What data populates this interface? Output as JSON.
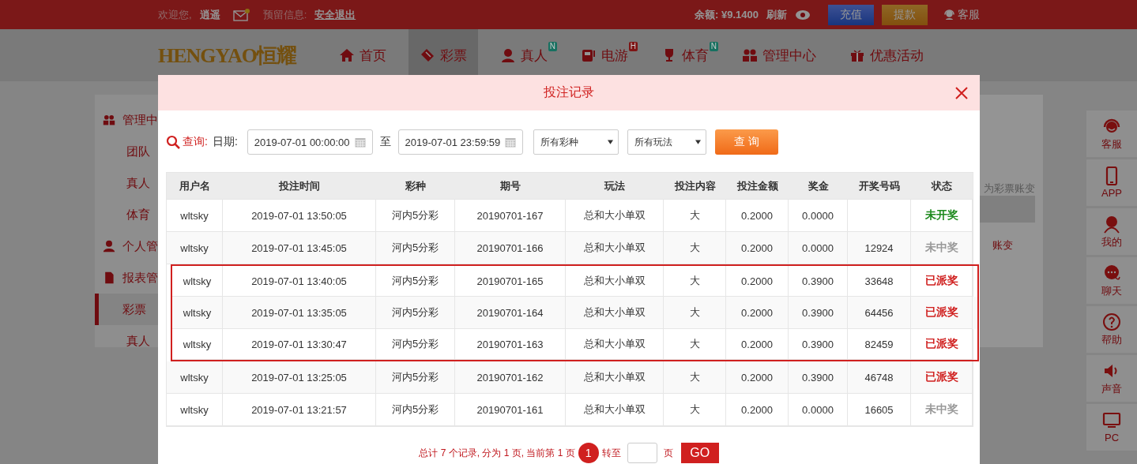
{
  "top_bar": {
    "welcome": "欢迎您,",
    "username": "逍遥",
    "reserved_label": "预留信息:",
    "logout": "安全退出",
    "balance": "余额: ¥9.1400",
    "refresh": "刷新",
    "deposit": "充值",
    "withdraw": "提款",
    "service": "客服"
  },
  "nav": {
    "logo": "HENGYAO恒耀",
    "items": [
      {
        "label": "首页",
        "selected": false
      },
      {
        "label": "彩票",
        "selected": true
      },
      {
        "label": "真人",
        "selected": false,
        "badge": {
          "text": "N",
          "color": "#177060"
        }
      },
      {
        "label": "电游",
        "selected": false,
        "badge": {
          "text": "H",
          "color": "#7e1414"
        }
      },
      {
        "label": "体育",
        "selected": false,
        "badge": {
          "text": "N",
          "color": "#177060"
        }
      },
      {
        "label": "管理中心",
        "selected": false
      },
      {
        "label": "优惠活动",
        "selected": false
      }
    ]
  },
  "sidebar": {
    "sections": [
      {
        "label": "管理中",
        "children": [
          {
            "label": "团队",
            "selected": false
          },
          {
            "label": "真人",
            "selected": false
          },
          {
            "label": "体育",
            "selected": false
          }
        ]
      },
      {
        "label": "个人管"
      },
      {
        "label": "报表管",
        "children": [
          {
            "label": "彩票",
            "selected": true
          },
          {
            "label": "真人",
            "selected": false
          }
        ]
      }
    ]
  },
  "background_panel": {
    "note": "为彩票账变",
    "row_text": "账变"
  },
  "side_toolbar": [
    {
      "label": "客服"
    },
    {
      "label": "APP"
    },
    {
      "label": "我的"
    },
    {
      "label": "聊天"
    },
    {
      "label": "帮助"
    },
    {
      "label": "声音"
    },
    {
      "label": "PC"
    }
  ],
  "modal": {
    "title": "投注记录",
    "query": {
      "label": "查询:",
      "date_label": "日期:",
      "start": "2019-07-01 00:00:00",
      "to": "至",
      "end": "2019-07-01 23:59:59",
      "lottery_select": "所有彩种",
      "play_select": "所有玩法",
      "button": "查 询"
    },
    "table": {
      "columns": [
        "用户名",
        "投注时间",
        "彩种",
        "期号",
        "玩法",
        "投注内容",
        "投注金额",
        "奖金",
        "开奖号码",
        "状态"
      ],
      "rows": [
        {
          "highlighted": false,
          "cells": [
            "wltsky",
            "2019-07-01 13:50:05",
            "河内5分彩",
            "20190701-167",
            "总和大小单双",
            "大",
            "0.2000",
            "0.0000",
            ""
          ],
          "status": {
            "text": "未开奖",
            "color": "#1e8a1e"
          }
        },
        {
          "highlighted": false,
          "cells": [
            "wltsky",
            "2019-07-01 13:45:05",
            "河内5分彩",
            "20190701-166",
            "总和大小单双",
            "大",
            "0.2000",
            "0.0000",
            "12924"
          ],
          "status": {
            "text": "未中奖",
            "color": "#999999"
          }
        },
        {
          "highlighted": true,
          "cells": [
            "wltsky",
            "2019-07-01 13:40:05",
            "河内5分彩",
            "20190701-165",
            "总和大小单双",
            "大",
            "0.2000",
            "0.3900",
            "33648"
          ],
          "status": {
            "text": "已派奖",
            "color": "#d0201f"
          }
        },
        {
          "highlighted": true,
          "cells": [
            "wltsky",
            "2019-07-01 13:35:05",
            "河内5分彩",
            "20190701-164",
            "总和大小单双",
            "大",
            "0.2000",
            "0.3900",
            "64456"
          ],
          "status": {
            "text": "已派奖",
            "color": "#d0201f"
          }
        },
        {
          "highlighted": true,
          "cells": [
            "wltsky",
            "2019-07-01 13:30:47",
            "河内5分彩",
            "20190701-163",
            "总和大小单双",
            "大",
            "0.2000",
            "0.3900",
            "82459"
          ],
          "status": {
            "text": "已派奖",
            "color": "#d0201f"
          }
        },
        {
          "highlighted": false,
          "cells": [
            "wltsky",
            "2019-07-01 13:25:05",
            "河内5分彩",
            "20190701-162",
            "总和大小单双",
            "大",
            "0.2000",
            "0.3900",
            "46748"
          ],
          "status": {
            "text": "已派奖",
            "color": "#d0201f"
          }
        },
        {
          "highlighted": false,
          "cells": [
            "wltsky",
            "2019-07-01 13:21:57",
            "河内5分彩",
            "20190701-161",
            "总和大小单双",
            "大",
            "0.2000",
            "0.0000",
            "16605"
          ],
          "status": {
            "text": "未中奖",
            "color": "#999999"
          }
        }
      ]
    },
    "pagination": {
      "summary": "总计 7 个记录, 分为 1 页, 当前第 1 页",
      "pages": [
        {
          "label": "1",
          "selected": true
        }
      ],
      "goto": "转至",
      "page_unit": "页",
      "go": "GO"
    }
  }
}
